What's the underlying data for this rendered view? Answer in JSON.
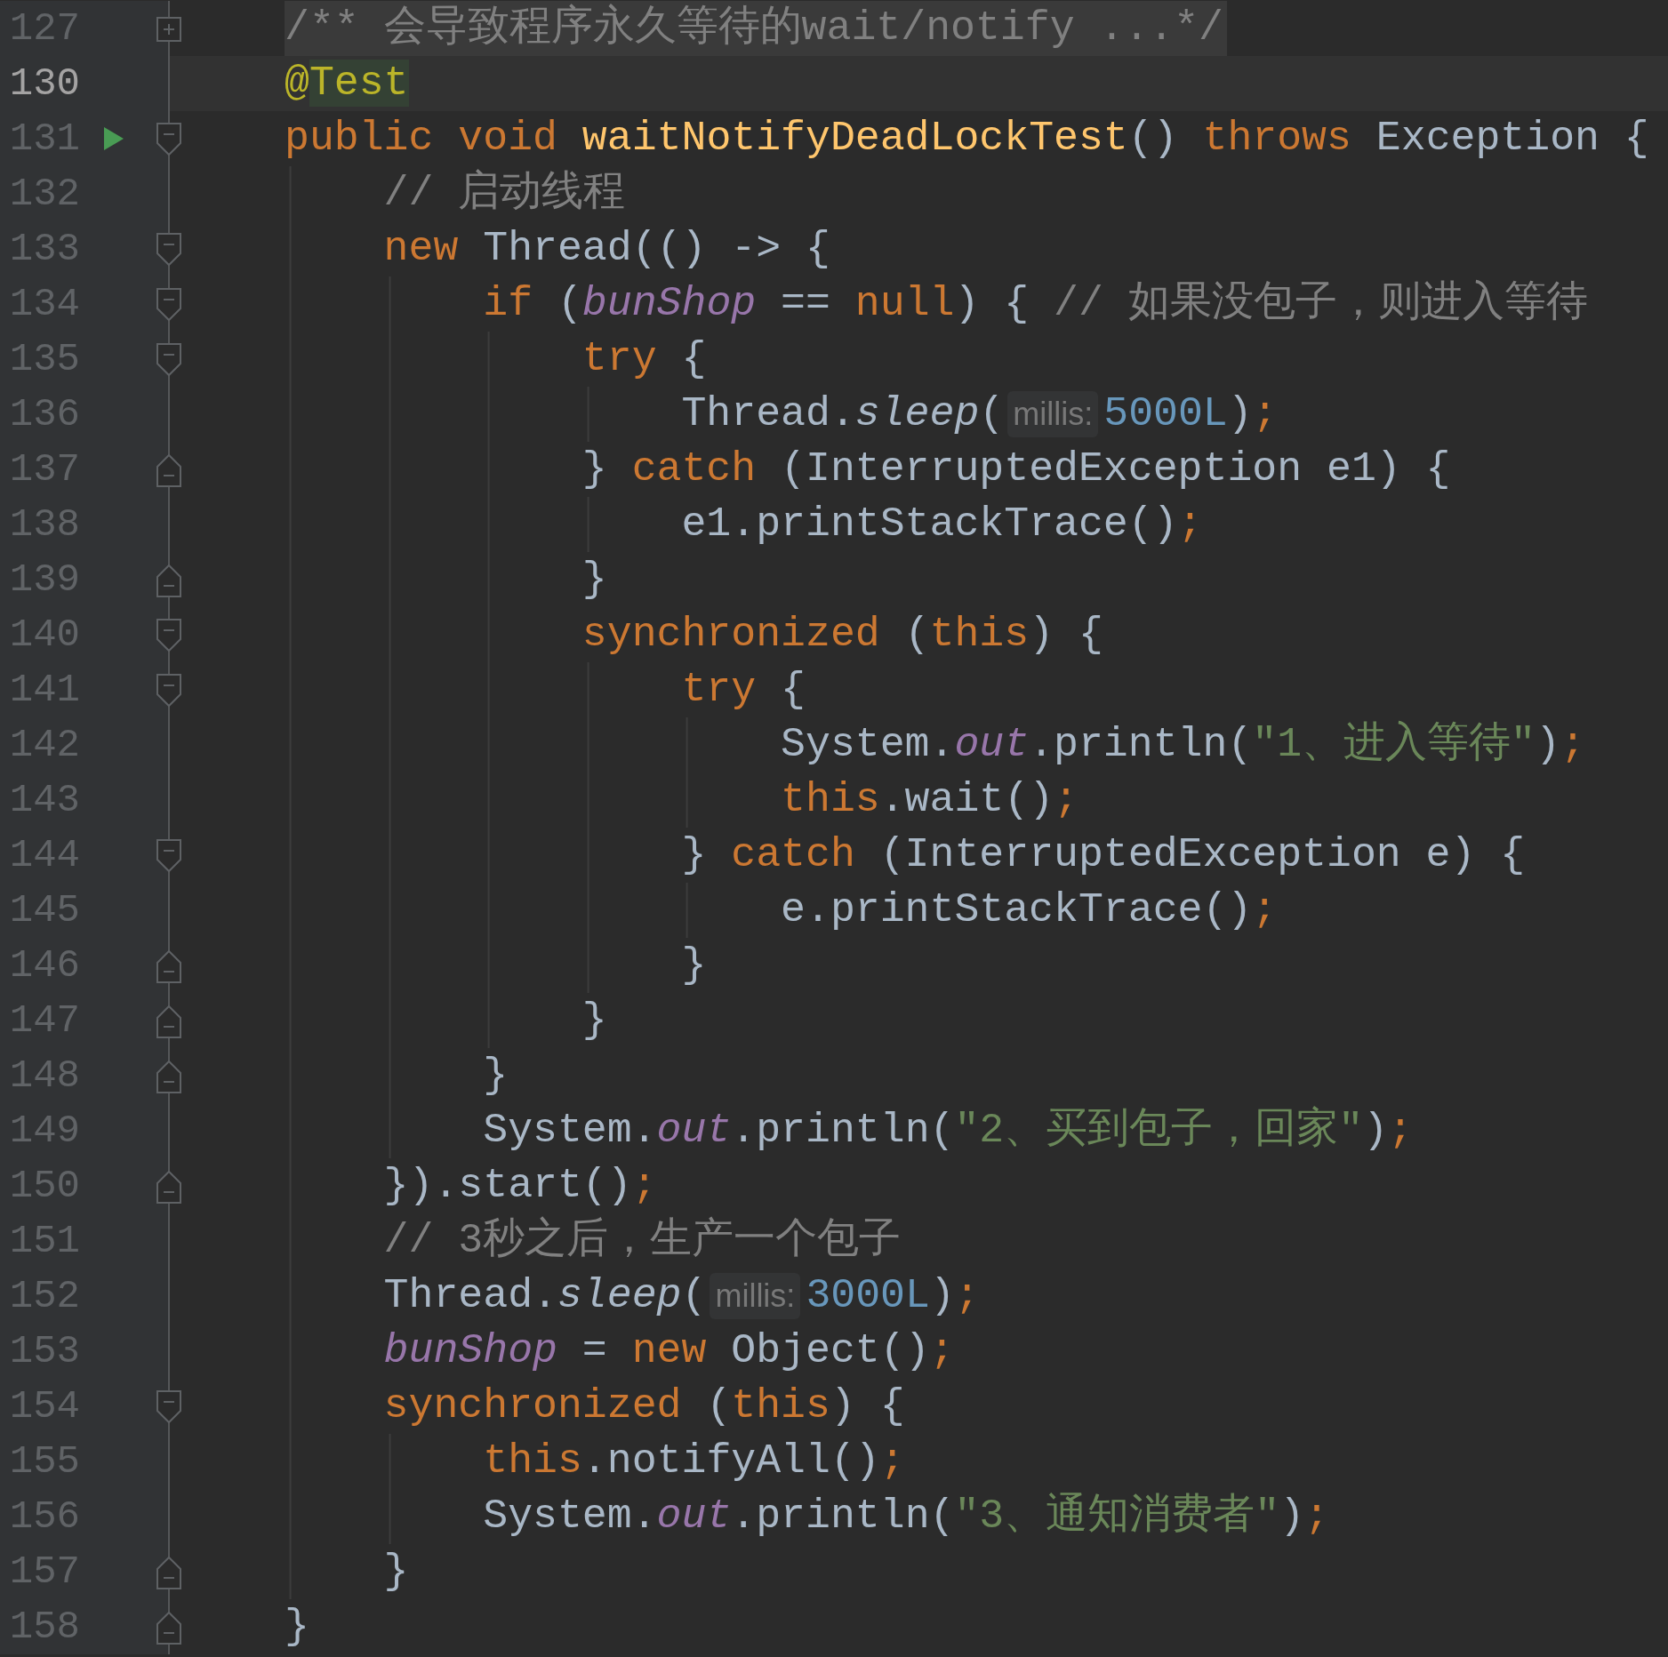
{
  "lines": [
    {
      "number": "127",
      "kind": "collapsed",
      "run": false,
      "current": false,
      "tokens": [
        {
          "kind": "folded",
          "text": "/** 会导致程序永久等待的wait/notify ...*/"
        }
      ]
    },
    {
      "number": "130",
      "kind": "plain",
      "run": false,
      "current": true,
      "tokens": [
        {
          "kind": "annotation",
          "text": "@"
        },
        {
          "kind": "match",
          "text": "Test"
        }
      ]
    },
    {
      "number": "131",
      "kind": "fold-start",
      "run": true,
      "current": false,
      "tokens": [
        {
          "kind": "keyword",
          "text": "public void "
        },
        {
          "kind": "method",
          "text": "waitNotifyDeadLockTest"
        },
        {
          "kind": "plain",
          "text": "() "
        },
        {
          "kind": "keyword",
          "text": "throws "
        },
        {
          "kind": "plain",
          "text": "Exception {"
        }
      ]
    },
    {
      "number": "132",
      "kind": "plain",
      "run": false,
      "current": false,
      "tokens": [
        {
          "kind": "comment",
          "text": "    // 启动线程"
        }
      ]
    },
    {
      "number": "133",
      "kind": "fold-start",
      "run": false,
      "current": false,
      "tokens": [
        {
          "kind": "keyword",
          "text": "    new "
        },
        {
          "kind": "plain",
          "text": "Thread(() -> {"
        }
      ]
    },
    {
      "number": "134",
      "kind": "fold-start",
      "run": false,
      "current": false,
      "tokens": [
        {
          "kind": "keyword",
          "text": "        if "
        },
        {
          "kind": "plain",
          "text": "("
        },
        {
          "kind": "field",
          "text": "bunShop"
        },
        {
          "kind": "plain",
          "text": " == "
        },
        {
          "kind": "keyword",
          "text": "null"
        },
        {
          "kind": "plain",
          "text": ") { "
        },
        {
          "kind": "comment",
          "text": "// 如果没包子，则进入等待"
        }
      ]
    },
    {
      "number": "135",
      "kind": "fold-start",
      "run": false,
      "current": false,
      "tokens": [
        {
          "kind": "keyword",
          "text": "            try "
        },
        {
          "kind": "plain",
          "text": "{"
        }
      ]
    },
    {
      "number": "136",
      "kind": "plain",
      "run": false,
      "current": false,
      "tokens": [
        {
          "kind": "plain",
          "text": "                Thread."
        },
        {
          "kind": "call",
          "text": "sleep"
        },
        {
          "kind": "plain",
          "text": "("
        },
        {
          "kind": "hint",
          "text": "millis:"
        },
        {
          "kind": "number",
          "text": "5000L"
        },
        {
          "kind": "plain",
          "text": ")"
        },
        {
          "kind": "keyword",
          "text": ";"
        }
      ]
    },
    {
      "number": "137",
      "kind": "fold-end",
      "run": false,
      "current": false,
      "tokens": [
        {
          "kind": "plain",
          "text": "            } "
        },
        {
          "kind": "keyword",
          "text": "catch "
        },
        {
          "kind": "plain",
          "text": "(InterruptedException e1) {"
        }
      ]
    },
    {
      "number": "138",
      "kind": "plain",
      "run": false,
      "current": false,
      "tokens": [
        {
          "kind": "plain",
          "text": "                e1.printStackTrace()"
        },
        {
          "kind": "keyword",
          "text": ";"
        }
      ]
    },
    {
      "number": "139",
      "kind": "fold-end",
      "run": false,
      "current": false,
      "tokens": [
        {
          "kind": "plain",
          "text": "            }"
        }
      ]
    },
    {
      "number": "140",
      "kind": "fold-start",
      "run": false,
      "current": false,
      "tokens": [
        {
          "kind": "keyword",
          "text": "            synchronized "
        },
        {
          "kind": "plain",
          "text": "("
        },
        {
          "kind": "keyword",
          "text": "this"
        },
        {
          "kind": "plain",
          "text": ") {"
        }
      ]
    },
    {
      "number": "141",
      "kind": "fold-start",
      "run": false,
      "current": false,
      "tokens": [
        {
          "kind": "keyword",
          "text": "                try "
        },
        {
          "kind": "plain",
          "text": "{"
        }
      ]
    },
    {
      "number": "142",
      "kind": "plain",
      "run": false,
      "current": false,
      "tokens": [
        {
          "kind": "plain",
          "text": "                    System."
        },
        {
          "kind": "field",
          "text": "out"
        },
        {
          "kind": "plain",
          "text": ".println("
        },
        {
          "kind": "string",
          "text": "\"1、进入等待\""
        },
        {
          "kind": "plain",
          "text": ")"
        },
        {
          "kind": "keyword",
          "text": ";"
        }
      ]
    },
    {
      "number": "143",
      "kind": "plain",
      "run": false,
      "current": false,
      "tokens": [
        {
          "kind": "keyword",
          "text": "                    this"
        },
        {
          "kind": "plain",
          "text": ".wait()"
        },
        {
          "kind": "keyword",
          "text": ";"
        }
      ]
    },
    {
      "number": "144",
      "kind": "fold-start",
      "run": false,
      "current": false,
      "tokens": [
        {
          "kind": "plain",
          "text": "                } "
        },
        {
          "kind": "keyword",
          "text": "catch "
        },
        {
          "kind": "plain",
          "text": "(InterruptedException e) {"
        }
      ]
    },
    {
      "number": "145",
      "kind": "plain",
      "run": false,
      "current": false,
      "tokens": [
        {
          "kind": "plain",
          "text": "                    e.printStackTrace()"
        },
        {
          "kind": "keyword",
          "text": ";"
        }
      ]
    },
    {
      "number": "146",
      "kind": "fold-end",
      "run": false,
      "current": false,
      "tokens": [
        {
          "kind": "plain",
          "text": "                }"
        }
      ]
    },
    {
      "number": "147",
      "kind": "fold-end",
      "run": false,
      "current": false,
      "tokens": [
        {
          "kind": "plain",
          "text": "            }"
        }
      ]
    },
    {
      "number": "148",
      "kind": "fold-end",
      "run": false,
      "current": false,
      "tokens": [
        {
          "kind": "plain",
          "text": "        }"
        }
      ]
    },
    {
      "number": "149",
      "kind": "plain",
      "run": false,
      "current": false,
      "tokens": [
        {
          "kind": "plain",
          "text": "        System."
        },
        {
          "kind": "field",
          "text": "out"
        },
        {
          "kind": "plain",
          "text": ".println("
        },
        {
          "kind": "string",
          "text": "\"2、买到包子，回家\""
        },
        {
          "kind": "plain",
          "text": ")"
        },
        {
          "kind": "keyword",
          "text": ";"
        }
      ]
    },
    {
      "number": "150",
      "kind": "fold-end",
      "run": false,
      "current": false,
      "tokens": [
        {
          "kind": "plain",
          "text": "    }).start()"
        },
        {
          "kind": "keyword",
          "text": ";"
        }
      ]
    },
    {
      "number": "151",
      "kind": "plain",
      "run": false,
      "current": false,
      "tokens": [
        {
          "kind": "comment",
          "text": "    // 3秒之后，生产一个包子"
        }
      ]
    },
    {
      "number": "152",
      "kind": "plain",
      "run": false,
      "current": false,
      "tokens": [
        {
          "kind": "plain",
          "text": "    Thread."
        },
        {
          "kind": "call",
          "text": "sleep"
        },
        {
          "kind": "plain",
          "text": "("
        },
        {
          "kind": "hint",
          "text": "millis:"
        },
        {
          "kind": "number",
          "text": "3000L"
        },
        {
          "kind": "plain",
          "text": ")"
        },
        {
          "kind": "keyword",
          "text": ";"
        }
      ]
    },
    {
      "number": "153",
      "kind": "plain",
      "run": false,
      "current": false,
      "tokens": [
        {
          "kind": "field",
          "text": "    bunShop"
        },
        {
          "kind": "plain",
          "text": " = "
        },
        {
          "kind": "keyword",
          "text": "new "
        },
        {
          "kind": "plain",
          "text": "Object()"
        },
        {
          "kind": "keyword",
          "text": ";"
        }
      ]
    },
    {
      "number": "154",
      "kind": "fold-start",
      "run": false,
      "current": false,
      "tokens": [
        {
          "kind": "keyword",
          "text": "    synchronized "
        },
        {
          "kind": "plain",
          "text": "("
        },
        {
          "kind": "keyword",
          "text": "this"
        },
        {
          "kind": "plain",
          "text": ") {"
        }
      ]
    },
    {
      "number": "155",
      "kind": "plain",
      "run": false,
      "current": false,
      "tokens": [
        {
          "kind": "keyword",
          "text": "        this"
        },
        {
          "kind": "plain",
          "text": ".notifyAll()"
        },
        {
          "kind": "keyword",
          "text": ";"
        }
      ]
    },
    {
      "number": "156",
      "kind": "plain",
      "run": false,
      "current": false,
      "tokens": [
        {
          "kind": "plain",
          "text": "        System."
        },
        {
          "kind": "field",
          "text": "out"
        },
        {
          "kind": "plain",
          "text": ".println("
        },
        {
          "kind": "string",
          "text": "\"3、通知消费者\""
        },
        {
          "kind": "plain",
          "text": ")"
        },
        {
          "kind": "keyword",
          "text": ";"
        }
      ]
    },
    {
      "number": "157",
      "kind": "fold-end",
      "run": false,
      "current": false,
      "tokens": [
        {
          "kind": "plain",
          "text": "    }"
        }
      ]
    },
    {
      "number": "158",
      "kind": "fold-end",
      "run": false,
      "current": false,
      "tokens": [
        {
          "kind": "plain",
          "text": "}"
        }
      ]
    }
  ]
}
